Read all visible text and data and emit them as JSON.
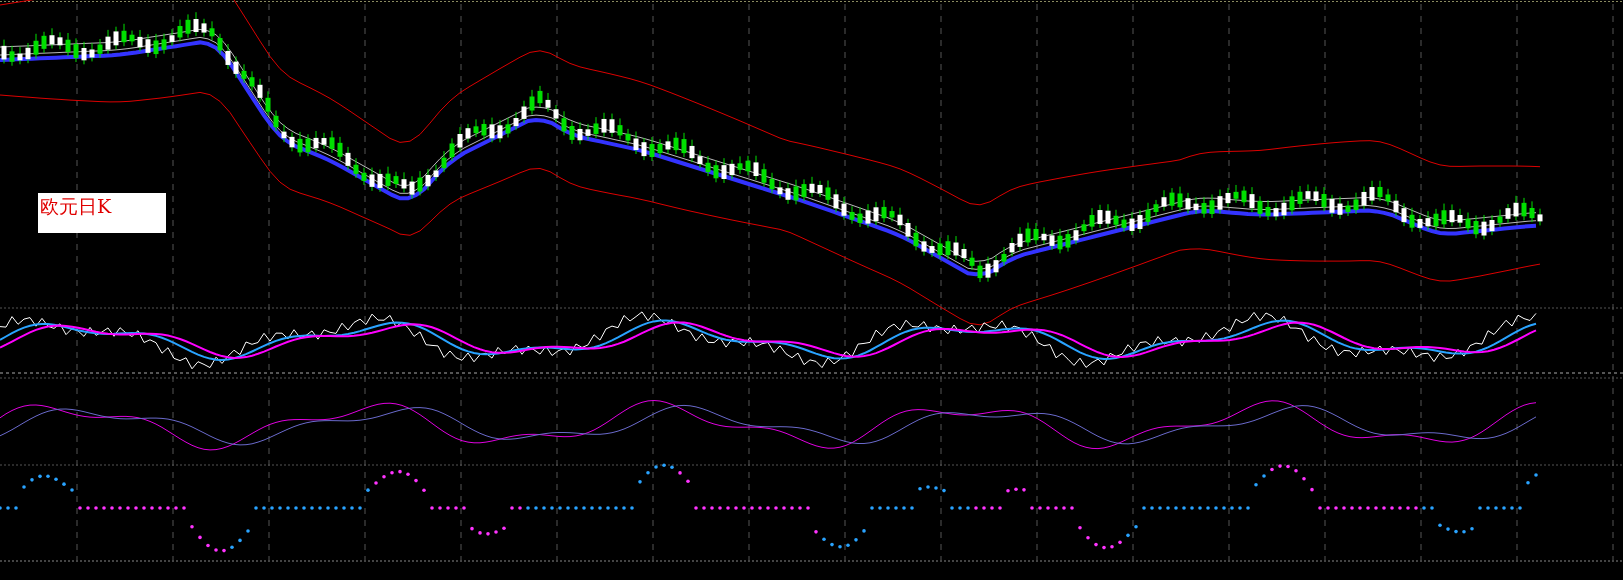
{
  "chart_label": "欧元日K"
}
